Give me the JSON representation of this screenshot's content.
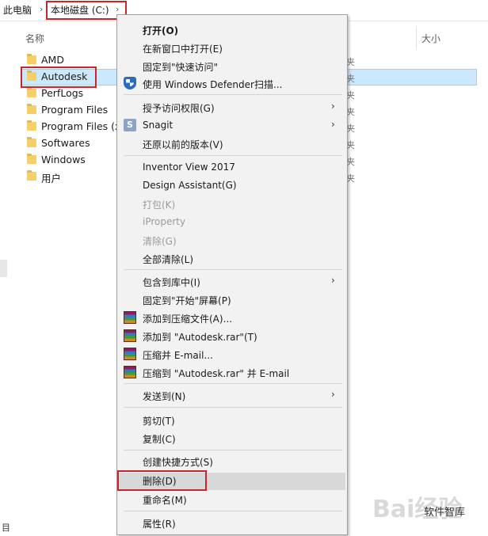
{
  "address": {
    "root": "此电脑",
    "drive": "本地磁盘 (C:)"
  },
  "columns": {
    "name": "名称",
    "size": "大小"
  },
  "files": [
    {
      "name": "AMD",
      "type": "夹"
    },
    {
      "name": "Autodesk",
      "type": "夹"
    },
    {
      "name": "PerfLogs",
      "type": "夹"
    },
    {
      "name": "Program Files",
      "type": "夹"
    },
    {
      "name": "Program Files (x",
      "type": "夹"
    },
    {
      "name": "Softwares",
      "type": "夹"
    },
    {
      "name": "Windows",
      "type": "夹"
    },
    {
      "name": "用户",
      "type": "夹"
    }
  ],
  "status": "目",
  "menu": {
    "open": "打开(O)",
    "open_new_window": "在新窗口中打开(E)",
    "pin_quick_access": "固定到\"快速访问\"",
    "defender": "使用 Windows Defender扫描...",
    "grant_access": "授予访问权限(G)",
    "snagit": "Snagit",
    "restore_versions": "还原以前的版本(V)",
    "inventor_view": "Inventor View 2017",
    "design_assistant": "Design Assistant(G)",
    "pack": "打包(K)",
    "iproperty": "iProperty",
    "clear": "清除(G)",
    "clear_all": "全部清除(L)",
    "include_library": "包含到库中(I)",
    "pin_start": "固定到\"开始\"屏幕(P)",
    "add_archive": "添加到压缩文件(A)...",
    "add_rar": "添加到 \"Autodesk.rar\"(T)",
    "compress_email": "压缩并 E-mail...",
    "compress_rar_email": "压缩到 \"Autodesk.rar\" 并 E-mail",
    "send_to": "发送到(N)",
    "cut": "剪切(T)",
    "copy": "复制(C)",
    "create_shortcut": "创建快捷方式(S)",
    "delete": "删除(D)",
    "rename": "重命名(M)",
    "properties": "属性(R)"
  },
  "watermark": {
    "logo": "Bai经验",
    "channel": "软件智库"
  }
}
